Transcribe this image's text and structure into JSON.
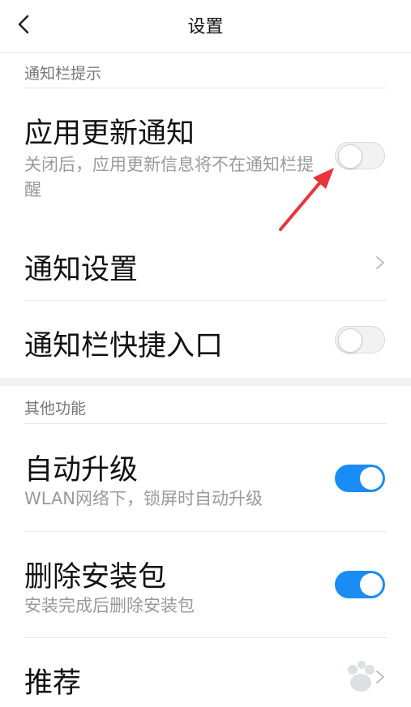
{
  "header": {
    "title": "设置",
    "back_icon": "chevron-left-icon"
  },
  "sections": {
    "notification": {
      "label": "通知栏提示",
      "app_update": {
        "title": "应用更新通知",
        "subtitle": "关闭后，应用更新信息将不在通知栏提醒",
        "enabled": false
      },
      "notification_settings": {
        "title": "通知设置"
      },
      "quick_entry": {
        "title": "通知栏快捷入口",
        "enabled": false
      }
    },
    "other": {
      "label": "其他功能",
      "auto_upgrade": {
        "title": "自动升级",
        "subtitle": "WLAN网络下，锁屏时自动升级",
        "enabled": true
      },
      "delete_package": {
        "title": "删除安装包",
        "subtitle": "安装完成后删除安装包",
        "enabled": true
      },
      "recommend": {
        "title": "推荐"
      }
    }
  },
  "colors": {
    "accent": "#1a8cf5",
    "annotation_arrow": "#e8343a",
    "separator": "#f2f2f2"
  }
}
